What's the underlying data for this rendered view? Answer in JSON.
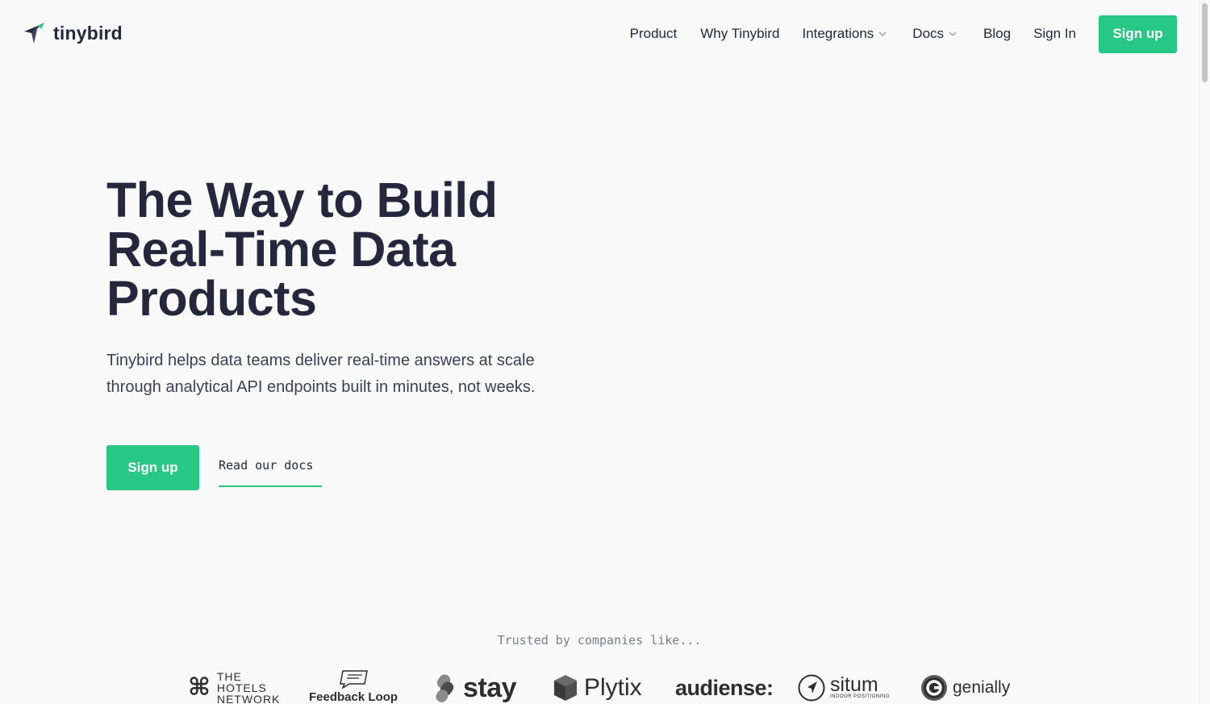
{
  "brand": {
    "name": "tinybird"
  },
  "nav": {
    "items": [
      "Product",
      "Why Tinybird",
      "Integrations",
      "Docs",
      "Blog",
      "Sign In"
    ],
    "signup_label": "Sign up"
  },
  "hero": {
    "title_lines": [
      "The Way to Build",
      "Real-Time Data",
      "Products"
    ],
    "subtitle_lines": [
      "Tinybird helps data teams deliver real-time answers at scale",
      "through analytical API endpoints built in minutes, not weeks."
    ],
    "signup_label": "Sign up",
    "docs_link": "Read our docs"
  },
  "trusted": {
    "heading": "Trusted by companies like...",
    "logos": {
      "hotels": [
        "THE",
        "HOTELS",
        "NETWORK"
      ],
      "feedback": "Feedback Loop",
      "stay": "stay",
      "plytix": "Plytix",
      "audiense": "audiense:",
      "situm": "situm",
      "situm_tag": "INDOOR POSITIONING",
      "genially": "genially"
    }
  },
  "colors": {
    "accent": "#27c886",
    "text": "#25283d",
    "background": "#f9f9f9"
  }
}
